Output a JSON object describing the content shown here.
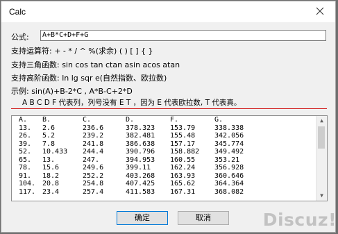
{
  "window": {
    "title": "Calc"
  },
  "formula": {
    "label": "公式:",
    "value": "A+B*C+D+F+G"
  },
  "help": {
    "operators": "支持运算符: + - * / ^ %(求余) ( ) [ ] { }",
    "trig": "支持三角函数: sin cos tan ctan asin acos atan",
    "advanced": "支持高阶函数: ln lg sqr e(自然指数、欧拉数)",
    "example": "示例: sin(A)+B-2*C , A*B-C+2*D",
    "columns_note": "A B C D F 代表列，列号没有 E T ，因为 E 代表欧拉数, T 代表真。"
  },
  "grid": {
    "headers": [
      "A.",
      "B.",
      "C.",
      "D.",
      "F.",
      "G."
    ],
    "rows": [
      [
        "13.",
        "2.6",
        "236.6",
        "378.323",
        "153.79",
        "338.338"
      ],
      [
        "26.",
        "5.2",
        "239.2",
        "382.481",
        "155.48",
        "342.056"
      ],
      [
        "39.",
        "7.8",
        "241.8",
        "386.638",
        "157.17",
        "345.774"
      ],
      [
        "52.",
        "10.433",
        "244.4",
        "390.796",
        "158.882",
        "349.492"
      ],
      [
        "65.",
        "13.",
        "247.",
        "394.953",
        "160.55",
        "353.21"
      ],
      [
        "78.",
        "15.6",
        "249.6",
        "399.11",
        "162.24",
        "356.928"
      ],
      [
        "91.",
        "18.2",
        "252.2",
        "403.268",
        "163.93",
        "360.646"
      ],
      [
        "104.",
        "20.8",
        "254.8",
        "407.425",
        "165.62",
        "364.364"
      ],
      [
        "117.",
        "23.4",
        "257.4",
        "411.583",
        "167.31",
        "368.082"
      ]
    ]
  },
  "buttons": {
    "ok": "确定",
    "cancel": "取消"
  },
  "watermark": "Discuz!"
}
